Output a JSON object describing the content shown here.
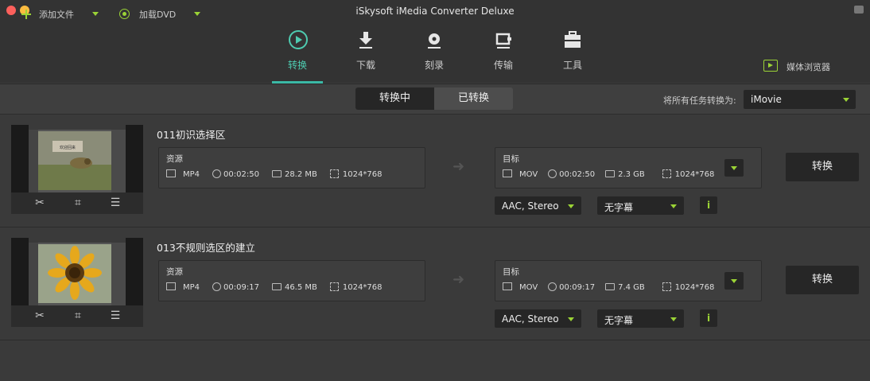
{
  "window": {
    "title": "iSkysoft iMedia Converter Deluxe"
  },
  "nav": {
    "items": [
      {
        "label": "转换",
        "icon": "convert-icon"
      },
      {
        "label": "下载",
        "icon": "download-icon"
      },
      {
        "label": "刻录",
        "icon": "burn-icon"
      },
      {
        "label": "传输",
        "icon": "transfer-icon"
      },
      {
        "label": "工具",
        "icon": "toolbox-icon"
      }
    ],
    "active": "转换",
    "media_browser": "媒体浏览器"
  },
  "toolbar": {
    "add_files": "添加文件",
    "load_dvd": "加载DVD",
    "tab_converting": "转换中",
    "tab_converted": "已转换",
    "convert_all_label": "将所有任务转换为:",
    "convert_all_target": "iMovie"
  },
  "items": [
    {
      "name": "011初识选择区",
      "source": {
        "header": "资源",
        "format": "MP4",
        "duration": "00:02:50",
        "size": "28.2 MB",
        "resolution": "1024*768"
      },
      "target": {
        "header": "目标",
        "format": "MOV",
        "duration": "00:02:50",
        "size": "2.3 GB",
        "resolution": "1024*768"
      },
      "audio": "AAC, Stereo",
      "subtitle": "无字幕",
      "info": "i",
      "convert": "转换",
      "thumb_text": "欢迎回来"
    },
    {
      "name": "013不规则选区的建立",
      "source": {
        "header": "资源",
        "format": "MP4",
        "duration": "00:09:17",
        "size": "46.5 MB",
        "resolution": "1024*768"
      },
      "target": {
        "header": "目标",
        "format": "MOV",
        "duration": "00:09:17",
        "size": "7.4 GB",
        "resolution": "1024*768"
      },
      "audio": "AAC, Stereo",
      "subtitle": "无字幕",
      "info": "i",
      "convert": "转换"
    }
  ],
  "colors": {
    "accent_teal": "#3bb9a6",
    "accent_green": "#9bd336",
    "bg": "#3a3a3a"
  }
}
